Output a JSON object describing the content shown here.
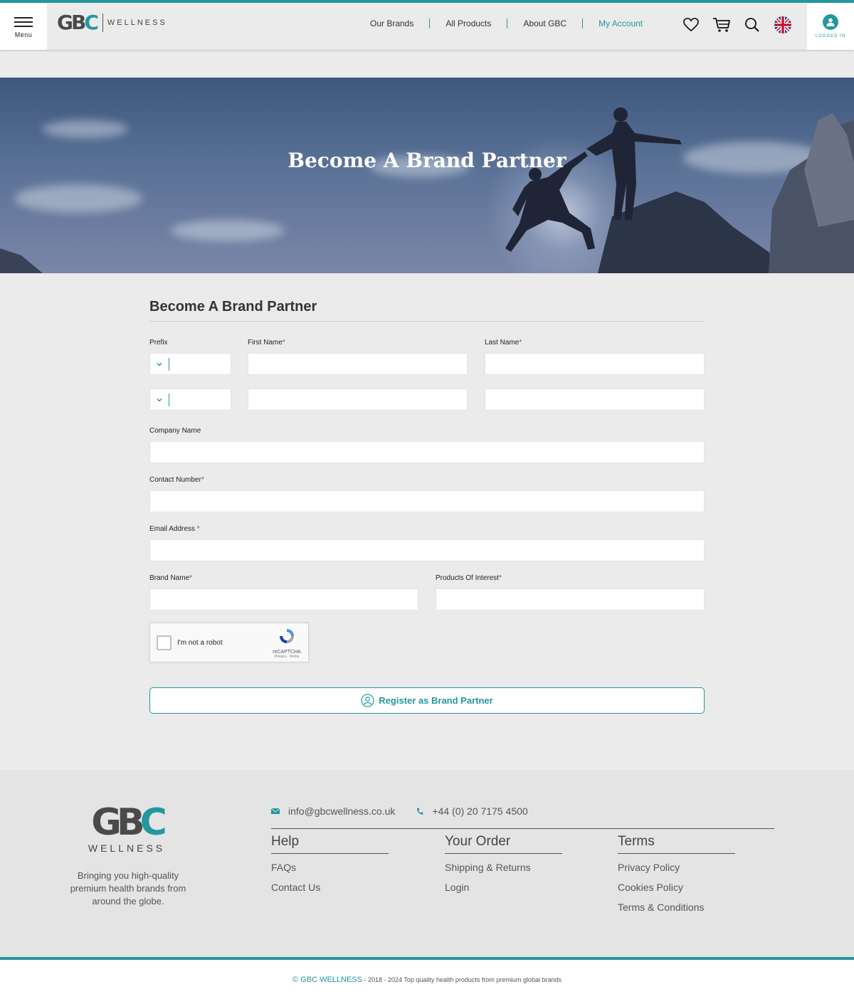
{
  "header": {
    "menu_label": "Menu",
    "logo": {
      "wordmark": "WELLNESS"
    },
    "nav": [
      {
        "label": "Our Brands",
        "active": false
      },
      {
        "label": "All Products",
        "active": false
      },
      {
        "label": "About GBC",
        "active": false
      },
      {
        "label": "My Account",
        "active": true
      }
    ],
    "icons": [
      "heart-icon",
      "cart-icon",
      "search-icon",
      "uk-flag-icon"
    ],
    "account_status": "LOGGED IN"
  },
  "hero": {
    "title": "Become A Brand Partner"
  },
  "form": {
    "title": "Become A Brand Partner",
    "labels": {
      "prefix": "Prefix",
      "first_name": "First Name",
      "last_name": "Last Name",
      "company_name": "Company Name",
      "contact_number": "Contact Number",
      "email_address": "Email Address",
      "brand_name": "Brand Name",
      "products_of_interest": "Products Of Interest"
    },
    "required_marker": "*",
    "captcha": {
      "label": "I'm not a robot",
      "brand": "reCAPTCHA",
      "links": "Privacy - Terms"
    },
    "submit_label": "Register as Brand Partner"
  },
  "footer": {
    "logo_wordmark": "WELLNESS",
    "tagline": "Bringing you high-quality premium health brands from around the globe.",
    "email": "info@gbcwellness.co.uk",
    "phone": "+44 (0) 20 7175 4500",
    "columns": [
      {
        "title": "Help",
        "links": [
          "FAQs",
          "Contact Us"
        ]
      },
      {
        "title": "Your Order",
        "links": [
          "Shipping & Returns",
          "Login"
        ]
      },
      {
        "title": "Terms",
        "links": [
          "Privacy Policy",
          "Cookies Policy",
          "Terms & Conditions"
        ]
      }
    ],
    "copyright_brand": "© GBC WELLNESS",
    "copyright_text": " - 2018 - 2024 Top quality health products from premium global brands"
  },
  "colors": {
    "accent": "#23979e",
    "background": "#ebebeb",
    "required": "#c0392b"
  }
}
